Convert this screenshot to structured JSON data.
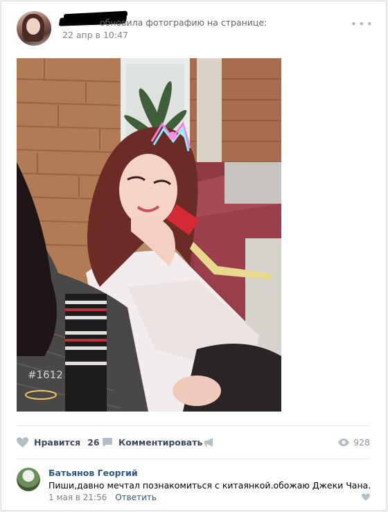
{
  "post": {
    "author_name": "",
    "action_text": "обновила фотографию на странице:",
    "date": "22 апр в 10:47",
    "menu_icon": "more-dots-icon",
    "photo_watermark": "#1612"
  },
  "footer": {
    "like_label": "Нравится",
    "like_count": "26",
    "comment_label": "Комментировать",
    "share_icon": "megaphone-icon",
    "views_count": "928"
  },
  "comment": {
    "author": "Батьянов Георгий",
    "text": "Пиши,давно мечтал познакомиться с китаянкой.обожаю Джеки Чана.",
    "date": "1 мая в 21:56",
    "reply_label": "Ответить"
  },
  "colors": {
    "link": "#2a5885",
    "muted": "#828282",
    "action": "#3c4a5c",
    "icon": "#b5bdc7"
  }
}
